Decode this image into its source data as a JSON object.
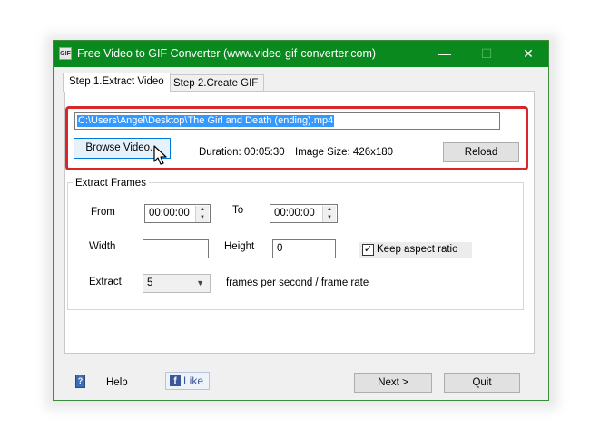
{
  "window": {
    "title": "Free Video to GIF Converter (www.video-gif-converter.com)",
    "app_icon_text": "GIF",
    "minimize_glyph": "—",
    "maximize_glyph": "☐",
    "close_glyph": "✕",
    "accent_color": "#0a8a1e"
  },
  "tabs": [
    {
      "label": "Step 1.Extract Video",
      "active": true
    },
    {
      "label": "Step 2.Create GIF",
      "active": false
    }
  ],
  "source": {
    "path": "C:\\Users\\Angel\\Desktop\\The Girl and Death (ending).mp4",
    "browse_label": "Browse Video...",
    "duration": "Duration: 00:05:30",
    "image_size": "Image Size: 426x180",
    "reload_label": "Reload",
    "highlight_color": "#d9262b"
  },
  "extract_frames": {
    "title": "Extract Frames",
    "from_label": "From",
    "from_value": "00:00:00",
    "to_label": "To",
    "to_value": "00:00:00",
    "width_label": "Width",
    "width_value": "",
    "height_label": "Height",
    "height_value": "0",
    "keep_aspect_label": "Keep aspect ratio",
    "keep_aspect_checked": true,
    "extract_label": "Extract",
    "extract_value": "5",
    "rate_label": "frames per second / frame rate"
  },
  "footer": {
    "help_icon_text": "?",
    "help_label": "Help",
    "like_icon_text": "f",
    "like_label": "Like",
    "next_label": "Next >",
    "quit_label": "Quit"
  }
}
